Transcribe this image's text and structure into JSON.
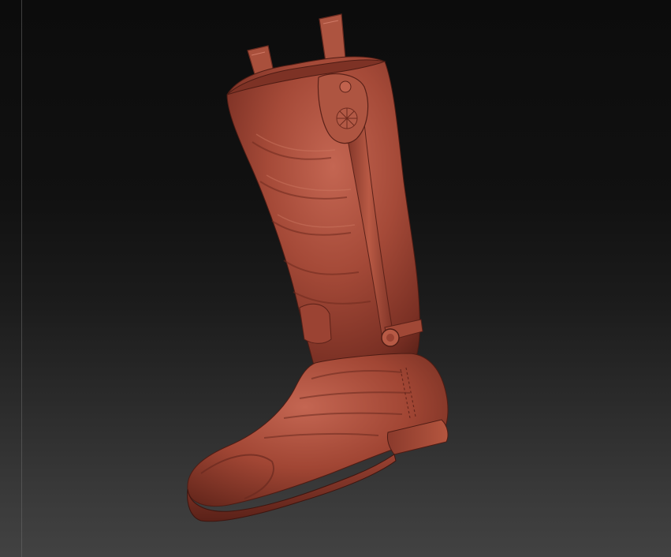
{
  "viewport": {
    "background_top": "#0c0c0c",
    "background_bottom": "#424242",
    "guide_line_color": "#6a6a6a"
  },
  "model": {
    "object": "boot",
    "material_color": "#a54a38",
    "material_shadow": "#5a2118",
    "material_highlight": "#d07a66"
  }
}
